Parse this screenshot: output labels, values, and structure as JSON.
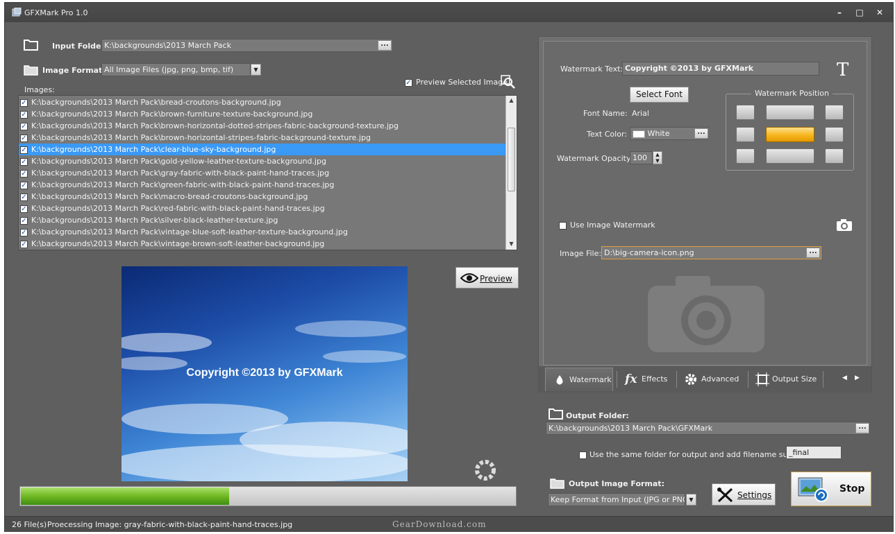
{
  "window": {
    "title": "GFXMark Pro 1.0"
  },
  "input": {
    "folder_label": "Input Folder:",
    "folder_value": "K:\\backgrounds\\2013 March Pack",
    "formats_label": "Image Formats:",
    "formats_value": "All Image Files (jpg, png, bmp, tif)",
    "preview_selected_label": "Preview Selected Image",
    "images_label": "Images:"
  },
  "images": [
    {
      "path": "K:\\backgrounds\\2013 March Pack\\bread-croutons-background.jpg",
      "checked": true,
      "selected": false
    },
    {
      "path": "K:\\backgrounds\\2013 March Pack\\brown-furniture-texture-background.jpg",
      "checked": true,
      "selected": false
    },
    {
      "path": "K:\\backgrounds\\2013 March Pack\\brown-horizontal-dotted-stripes-fabric-background-texture.jpg",
      "checked": true,
      "selected": false
    },
    {
      "path": "K:\\backgrounds\\2013 March Pack\\brown-horizontal-stripes-fabric-background-texture.jpg",
      "checked": true,
      "selected": false
    },
    {
      "path": "K:\\backgrounds\\2013 March Pack\\clear-blue-sky-background.jpg",
      "checked": true,
      "selected": true
    },
    {
      "path": "K:\\backgrounds\\2013 March Pack\\gold-yellow-leather-texture-background.jpg",
      "checked": true,
      "selected": false
    },
    {
      "path": "K:\\backgrounds\\2013 March Pack\\gray-fabric-with-black-paint-hand-traces.jpg",
      "checked": true,
      "selected": false
    },
    {
      "path": "K:\\backgrounds\\2013 March Pack\\green-fabric-with-black-paint-hand-traces.jpg",
      "checked": true,
      "selected": false
    },
    {
      "path": "K:\\backgrounds\\2013 March Pack\\macro-bread-croutons-background.jpg",
      "checked": true,
      "selected": false
    },
    {
      "path": "K:\\backgrounds\\2013 March Pack\\red-fabric-with-black-paint-hand-traces.jpg",
      "checked": true,
      "selected": false
    },
    {
      "path": "K:\\backgrounds\\2013 March Pack\\silver-black-leather-texture.jpg",
      "checked": true,
      "selected": false
    },
    {
      "path": "K:\\backgrounds\\2013 March Pack\\vintage-blue-soft-leather-texture-background.jpg",
      "checked": true,
      "selected": false
    },
    {
      "path": "K:\\backgrounds\\2013 March Pack\\vintage-brown-soft-leather-background.jpg",
      "checked": true,
      "selected": false
    }
  ],
  "preview": {
    "button_label": "Preview",
    "watermark_overlay": "Copyright ©2013 by GFXMark"
  },
  "progress": {
    "percent": 42
  },
  "status": {
    "file_count": "26 File(s)",
    "processing": "Proecessing Image:  gray-fabric-with-black-paint-hand-traces.jpg"
  },
  "watermark": {
    "text_label": "Watermark Text:",
    "text_value": "Copyright ©2013 by GFXMark",
    "select_font_label": "Select Font",
    "font_name_label": "Font Name:",
    "font_name_value": "Arial",
    "text_color_label": "Text Color:",
    "text_color_value": "White",
    "opacity_label": "Watermark Opacity:",
    "opacity_value": "100",
    "position_title": "Watermark Position",
    "position_active": "middle-center",
    "use_image_label": "Use Image Watermark",
    "image_file_label": "Image File:",
    "image_file_value": "D:\\big-camera-icon.png"
  },
  "tabs": [
    {
      "label": "Watermark",
      "active": true
    },
    {
      "label": "Effects",
      "active": false
    },
    {
      "label": "Advanced",
      "active": false
    },
    {
      "label": "Output Size",
      "active": false
    }
  ],
  "output": {
    "folder_label": "Output Folder:",
    "folder_value": "K:\\backgrounds\\2013 March Pack\\GFXMark",
    "same_folder_label": "Use the same folder for output and add filename suffix",
    "suffix_value": "_final",
    "format_label": "Output Image Format:",
    "format_value": "Keep Format from Input (JPG or PNG)",
    "settings_label": "Settings",
    "stop_label": "Stop"
  },
  "site_watermark": "GearDownload.com",
  "colors": {
    "accent_selection": "#3a99f5",
    "progress_green": "#6fb821",
    "active_position": "#f7b51e"
  }
}
